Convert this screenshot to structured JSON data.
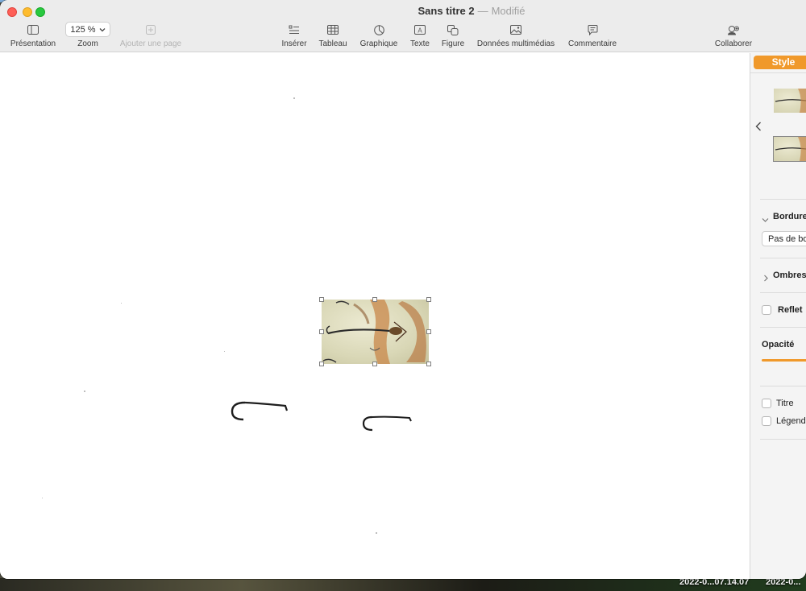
{
  "window": {
    "doc_title": "Sans titre 2",
    "separator": "—",
    "status": "Modifié"
  },
  "toolbar": {
    "presentation": {
      "label": "Présentation",
      "icon": "sidebar-icon"
    },
    "zoom": {
      "label": "Zoom",
      "value": "125 %",
      "icon": "chevron-down-icon"
    },
    "add_page": {
      "label": "Ajouter une page",
      "icon": "add-page-icon"
    },
    "insert": {
      "label": "Insérer",
      "icon": "insert-list-icon"
    },
    "table": {
      "label": "Tableau",
      "icon": "table-icon"
    },
    "chart": {
      "label": "Graphique",
      "icon": "chart-icon"
    },
    "text": {
      "label": "Texte",
      "icon": "text-box-icon"
    },
    "shape": {
      "label": "Figure",
      "icon": "shape-icon"
    },
    "media": {
      "label": "Données multimédias",
      "icon": "photo-icon"
    },
    "comment": {
      "label": "Commentaire",
      "icon": "comment-icon"
    },
    "collaborate": {
      "label": "Collaborer",
      "icon": "collaborate-icon"
    }
  },
  "sidebar": {
    "style_tab": "Style",
    "border_header": "Bordure",
    "border_value": "Pas de bo",
    "shadows": "Ombres",
    "reflection": "Reflet",
    "opacity": "Opacité",
    "title_option": "Titre",
    "caption_option": "Légend"
  },
  "desktop": {
    "file1": "2022-0...07.14.07",
    "file2": "2022-0..."
  },
  "colors": {
    "accent": "#f0992b",
    "close": "#fe5f57",
    "minimize": "#febc2e",
    "maximize": "#28c840"
  }
}
